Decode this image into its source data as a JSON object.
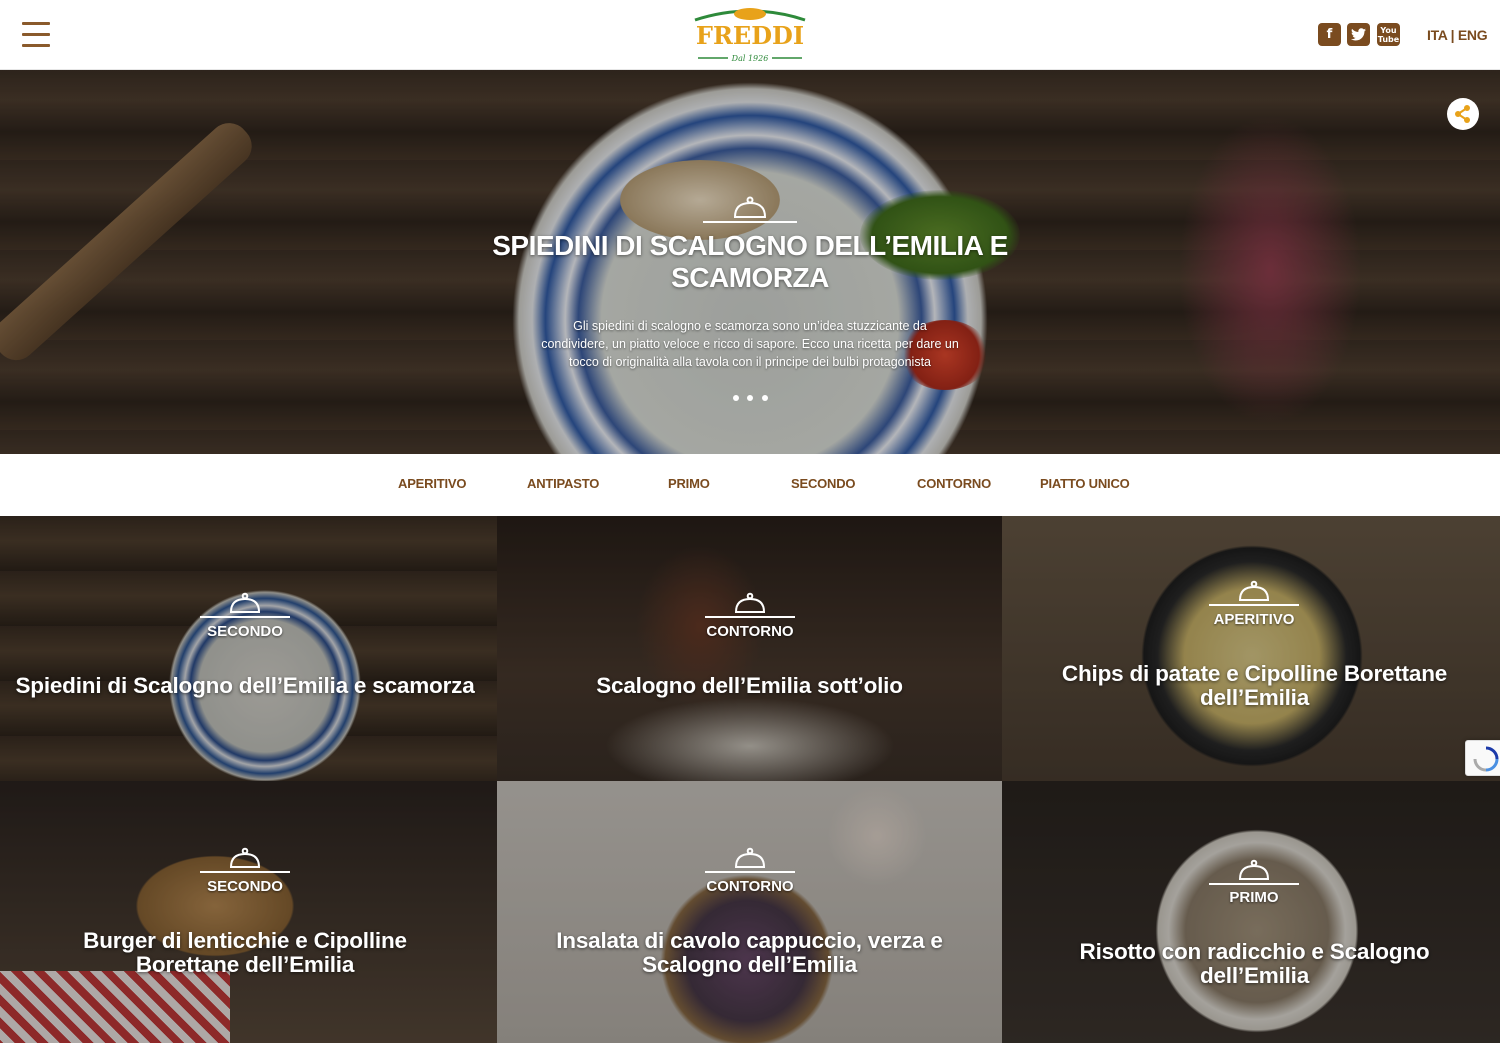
{
  "header": {
    "logo": {
      "brand": "FREDDI",
      "since": "Dal 1926"
    },
    "social": [
      {
        "label": "f",
        "icon": "facebook-icon"
      },
      {
        "label": "t",
        "icon": "twitter-icon"
      },
      {
        "label": "You Tube",
        "icon": "youtube-icon"
      }
    ],
    "lang": {
      "ita": "ITA",
      "sep": " | ",
      "eng": "ENG"
    },
    "accent_color": "#7a4b1f",
    "logo_green": "#2e8a3a",
    "logo_orange": "#e8a21a"
  },
  "hero": {
    "title": "SPIEDINI DI SCALOGNO DELL’EMILIA E SCAMORZA",
    "description": "Gli spiedini di scalogno e scamorza sono un’idea stuzzicante da condividere, un piatto veloce e ricco di sapore. Ecco una ricetta per dare un tocco di originalità alla tavola con il principe dei bulbi protagonista",
    "slides": 3,
    "share_icon": "share-icon",
    "dish_icon": "cloche-icon"
  },
  "categories": [
    "APERITIVO",
    "ANTIPASTO",
    "PRIMO",
    "SECONDO",
    "CONTORNO",
    "PIATTO UNICO"
  ],
  "recipes": [
    {
      "category": "SECONDO",
      "title": "Spiedini di Scalogno dell’Emilia e scamorza"
    },
    {
      "category": "CONTORNO",
      "title": "Scalogno dell’Emilia sott’olio"
    },
    {
      "category": "APERITIVO",
      "title": "Chips di patate e Cipolline Borettane dell’Emilia"
    },
    {
      "category": "SECONDO",
      "title": "Burger di lenticchie e Cipolline Borettane dell’Emilia"
    },
    {
      "category": "CONTORNO",
      "title": "Insalata di cavolo cappuccio, verza e Scalogno dell’Emilia"
    },
    {
      "category": "PRIMO",
      "title": "Risotto con radicchio e Scalogno dell’Emilia"
    }
  ]
}
